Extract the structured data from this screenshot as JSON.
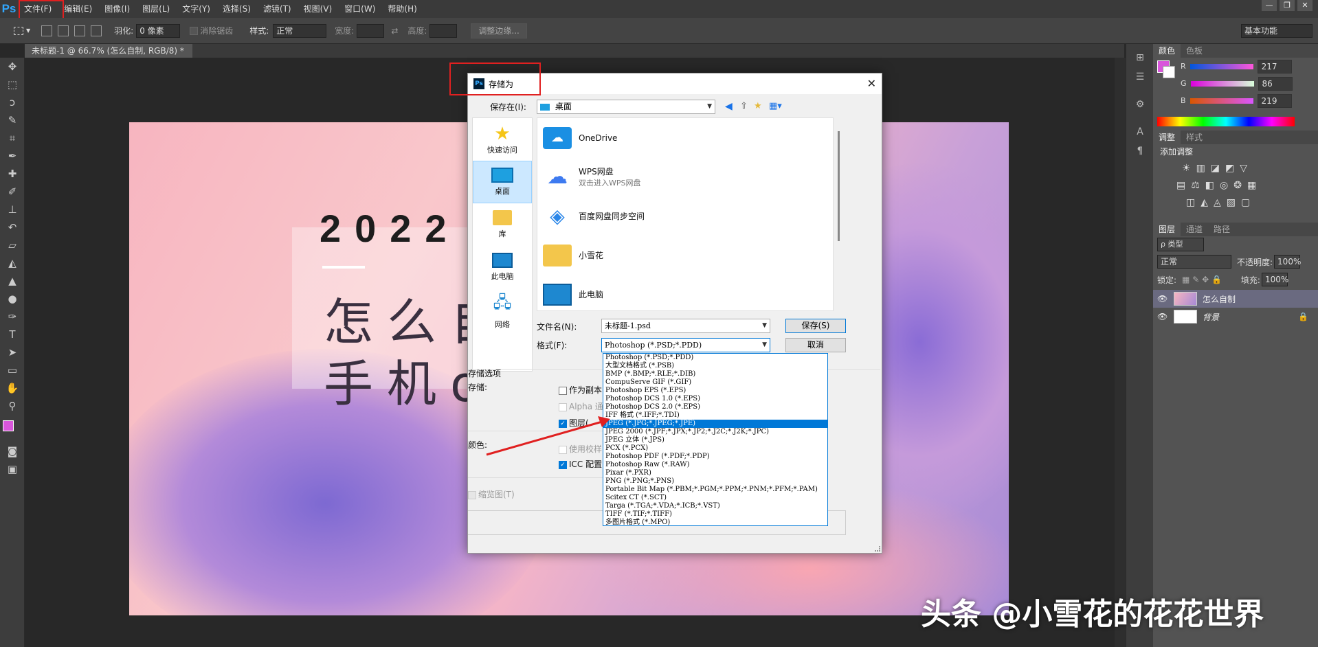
{
  "app": {
    "logo": "Ps"
  },
  "menu": [
    "文件(F)",
    "编辑(E)",
    "图像(I)",
    "图层(L)",
    "文字(Y)",
    "选择(S)",
    "滤镜(T)",
    "视图(V)",
    "窗口(W)",
    "帮助(H)"
  ],
  "options": {
    "feather_label": "羽化:",
    "feather_value": "0 像素",
    "antialias_label": "消除锯齿",
    "style_label": "样式:",
    "style_value": "正常",
    "width_label": "宽度:",
    "height_label": "高度:",
    "refine_edge": "调整边缘...",
    "workspace": "基本功能"
  },
  "doc_tab": "未标题-1 @ 66.7% (怎么自制, RGB/8) *",
  "poster": {
    "year": "2022",
    "line1": "怎么自",
    "line2": "手机o"
  },
  "panels": {
    "color_tabs": [
      "颜色",
      "色板"
    ],
    "r": "217",
    "g": "86",
    "b": "219",
    "r_label": "R",
    "g_label": "G",
    "b_label": "B",
    "adjust_tabs": [
      "调整",
      "样式"
    ],
    "adjust_title": "添加调整",
    "layer_tabs": [
      "图层",
      "通道",
      "路径"
    ],
    "layer_filter": "ρ 类型",
    "blend_mode": "正常",
    "opacity_label": "不透明度:",
    "opacity_value": "100%",
    "lock_label": "锁定:",
    "fill_label": "填充:",
    "fill_value": "100%",
    "layers": [
      {
        "name": "怎么自制"
      },
      {
        "name": "背景"
      }
    ]
  },
  "dialog": {
    "title": "存储为",
    "save_in_label": "保存在(I):",
    "save_in_value": "桌面",
    "places": [
      {
        "label": "快速访问",
        "icon": "star-icon"
      },
      {
        "label": "桌面",
        "icon": "desktop-icon"
      },
      {
        "label": "库",
        "icon": "library-icon"
      },
      {
        "label": "此电脑",
        "icon": "computer-icon"
      },
      {
        "label": "网络",
        "icon": "network-icon"
      }
    ],
    "files": [
      {
        "name": "OneDrive",
        "sub": ""
      },
      {
        "name": "WPS网盘",
        "sub": "双击进入WPS网盘"
      },
      {
        "name": "百度网盘同步空间",
        "sub": ""
      },
      {
        "name": "小雪花",
        "sub": ""
      },
      {
        "name": "此电脑",
        "sub": ""
      }
    ],
    "filename_label": "文件名(N):",
    "filename_value": "未标题-1.psd",
    "format_label": "格式(F):",
    "format_value": "Photoshop (*.PSD;*.PDD)",
    "save_button": "保存(S)",
    "cancel_button": "取消",
    "save_options_title": "存储选项",
    "save_label": "存储:",
    "opt_copy": "作为副本",
    "opt_alpha": "Alpha 通",
    "opt_layers": "图层(",
    "color_label": "颜色:",
    "opt_proof": "使用校样",
    "opt_icc": "ICC 配置",
    "opt_thumb": "缩览图(T)",
    "formats": [
      "Photoshop (*.PSD;*.PDD)",
      "大型文档格式 (*.PSB)",
      "BMP (*.BMP;*.RLE;*.DIB)",
      "CompuServe GIF (*.GIF)",
      "Photoshop EPS (*.EPS)",
      "Photoshop DCS 1.0 (*.EPS)",
      "Photoshop DCS 2.0 (*.EPS)",
      "IFF 格式 (*.IFF;*.TDI)",
      "JPEG (*.JPG;*.JPEG;*.JPE)",
      "JPEG 2000 (*.JPF;*.JPX;*.JP2;*.J2C;*.J2K;*.JPC)",
      "JPEG 立体 (*.JPS)",
      "PCX (*.PCX)",
      "Photoshop PDF (*.PDF;*.PDP)",
      "Photoshop Raw (*.RAW)",
      "Pixar (*.PXR)",
      "PNG (*.PNG;*.PNS)",
      "Portable Bit Map (*.PBM;*.PGM;*.PPM;*.PNM;*.PFM;*.PAM)",
      "Scitex CT (*.SCT)",
      "Targa (*.TGA;*.VDA;*.ICB;*.VST)",
      "TIFF (*.TIF;*.TIFF)",
      "多图片格式 (*.MPO)"
    ],
    "highlighted_format": "JPEG (*.JPG;*.JPEG;*.JPE)"
  },
  "watermark": "头条 @小雪花的花花世界",
  "colors": {
    "foreground": "#d956db",
    "accent": "#0078d7",
    "annotation": "#e02020"
  }
}
